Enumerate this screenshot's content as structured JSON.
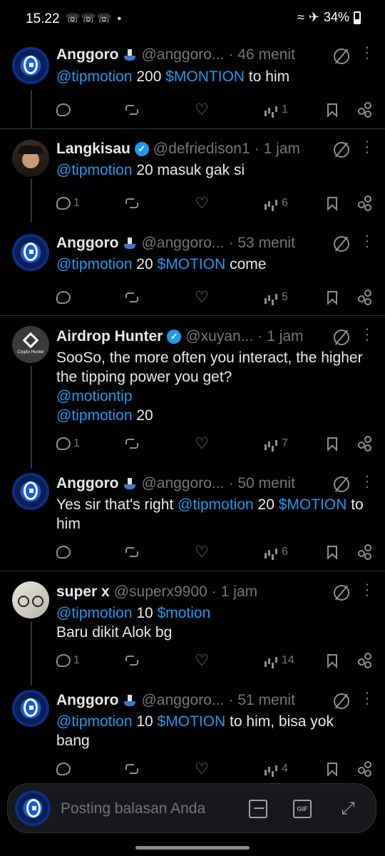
{
  "status_bar": {
    "time": "15.22",
    "battery": "34%"
  },
  "tweets": [
    {
      "name": "Anggoro",
      "handle": "@anggoro...",
      "dot": "·",
      "time": "46 menit",
      "body": [
        [
          "link",
          "@tipmotion"
        ],
        [
          "text",
          " 200 "
        ],
        [
          "link",
          "$MONTION"
        ],
        [
          "text",
          " to him"
        ]
      ],
      "reply": "",
      "views": "1"
    },
    {
      "name": "Langkisau",
      "handle": "@defriedison1",
      "dot": "·",
      "time": "1 jam",
      "body": [
        [
          "link",
          "@tipmotion"
        ],
        [
          "text",
          " 20 masuk gak si"
        ]
      ],
      "reply": "1",
      "views": "6"
    },
    {
      "name": "Anggoro",
      "handle": "@anggoro...",
      "dot": "·",
      "time": "53 menit",
      "body": [
        [
          "link",
          "@tipmotion"
        ],
        [
          "text",
          " 20 "
        ],
        [
          "link",
          "$MOTION"
        ],
        [
          "text",
          " come"
        ]
      ],
      "reply": "",
      "views": "5"
    },
    {
      "name": "Airdrop Hunter",
      "handle": "@xuyan...",
      "dot": "·",
      "time": "1 jam",
      "avatar_caption": "Crypto Hunter",
      "body": [
        [
          "text",
          "SooSo, the more often you interact, the higher the tipping power you get?"
        ],
        [
          "br",
          ""
        ],
        [
          "link",
          "@motiontip"
        ],
        [
          "br",
          ""
        ],
        [
          "link",
          "@tipmotion"
        ],
        [
          "text",
          " 20"
        ]
      ],
      "reply": "1",
      "views": "7"
    },
    {
      "name": "Anggoro",
      "handle": "@anggoro...",
      "dot": "·",
      "time": "50 menit",
      "body": [
        [
          "text",
          "Yes sir that's right "
        ],
        [
          "link",
          "@tipmotion"
        ],
        [
          "text",
          " 20 "
        ],
        [
          "link",
          "$MOTION"
        ],
        [
          "text",
          " to him"
        ]
      ],
      "reply": "",
      "views": "6"
    },
    {
      "name": "super x",
      "handle": "@superx9900",
      "dot": "·",
      "time": "1 jam",
      "body": [
        [
          "link",
          "@tipmotion"
        ],
        [
          "text",
          " 10 "
        ],
        [
          "link",
          "$motion"
        ],
        [
          "br",
          ""
        ],
        [
          "text",
          "Baru dikit Alok bg"
        ]
      ],
      "reply": "1",
      "views": "14"
    },
    {
      "name": "Anggoro",
      "handle": "@anggoro...",
      "dot": "·",
      "time": "51 menit",
      "body": [
        [
          "link",
          "@tipmotion"
        ],
        [
          "text",
          " 10 "
        ],
        [
          "link",
          "$MOTION"
        ],
        [
          "text",
          " to him, bisa yok bang"
        ]
      ],
      "reply": "",
      "views": "4"
    }
  ],
  "composer": {
    "placeholder": "Posting balasan Anda",
    "gif_label": "GIF"
  },
  "colors": {
    "link": "#1d9bf0",
    "verified": "#1d9bf0",
    "muted": "#71767b"
  }
}
